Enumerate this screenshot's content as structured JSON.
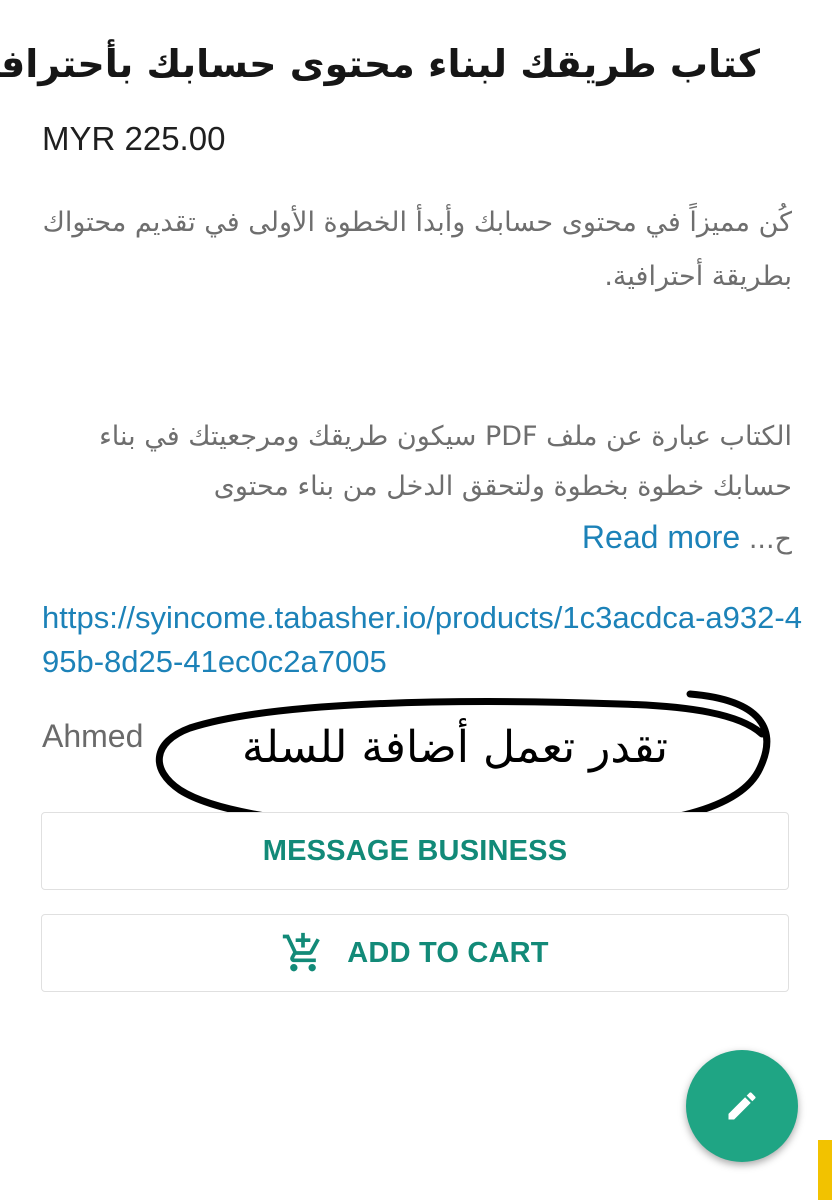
{
  "product": {
    "title": "كتاب طريقك لبناء محتوى حسابك بأحترافية",
    "price": "MYR 225.00",
    "short_description": "كُن مميزاً في محتوى حسابك وأبدأ الخطوة الأولى في تقديم محتواك بطريقة أحترافية.",
    "long_description": "الكتاب عبارة عن ملف PDF سيكون طريقك ومرجعيتك في بناء حسابك خطوة بخطوة ولتحقق الدخل من بناء محتوى",
    "truncated_tail": "ح...",
    "read_more_label": "Read more",
    "link": "https://syincome.tabasher.io/products/1c3acdca-a932-495b-8d25-41ec0c2a7005",
    "seller": "Ahmed"
  },
  "annotation": {
    "text": "تقدر تعمل أضافة للسلة"
  },
  "actions": {
    "message_label": "MESSAGE BUSINESS",
    "cart_label": "ADD TO CART"
  },
  "fab": {
    "icon": "pencil-icon"
  },
  "colors": {
    "accent": "#128a78",
    "link": "#1c82b8",
    "fab": "#1fa584"
  }
}
